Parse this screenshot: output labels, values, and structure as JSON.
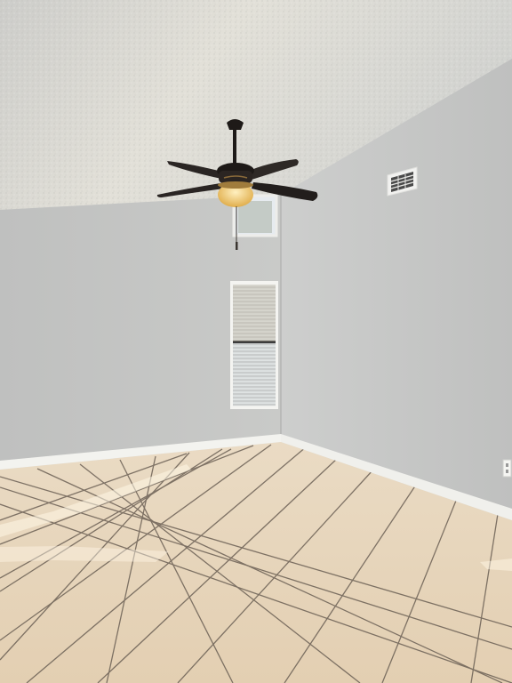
{
  "scene": {
    "description_free": true,
    "colors": {
      "ceiling": "#d9d9d5",
      "ceiling_shadow": "#b9bab6",
      "left_wall": "#c3c4c2",
      "right_wall": "#c6c7c6",
      "baseboard": "#f2f2ee",
      "floor_tile": "#e8d6bc",
      "floor_tile_light": "#f1e4cf",
      "grout": "#5a5148",
      "fan_body": "#1e1a18",
      "fan_light": "#f2c86a",
      "window_glass": "#e9edf0",
      "blind_slat": "#d4d6d6"
    },
    "icons": {
      "fan": "ceiling-fan-icon",
      "vent": "air-vent-icon",
      "outlet": "wall-outlet-icon"
    }
  }
}
